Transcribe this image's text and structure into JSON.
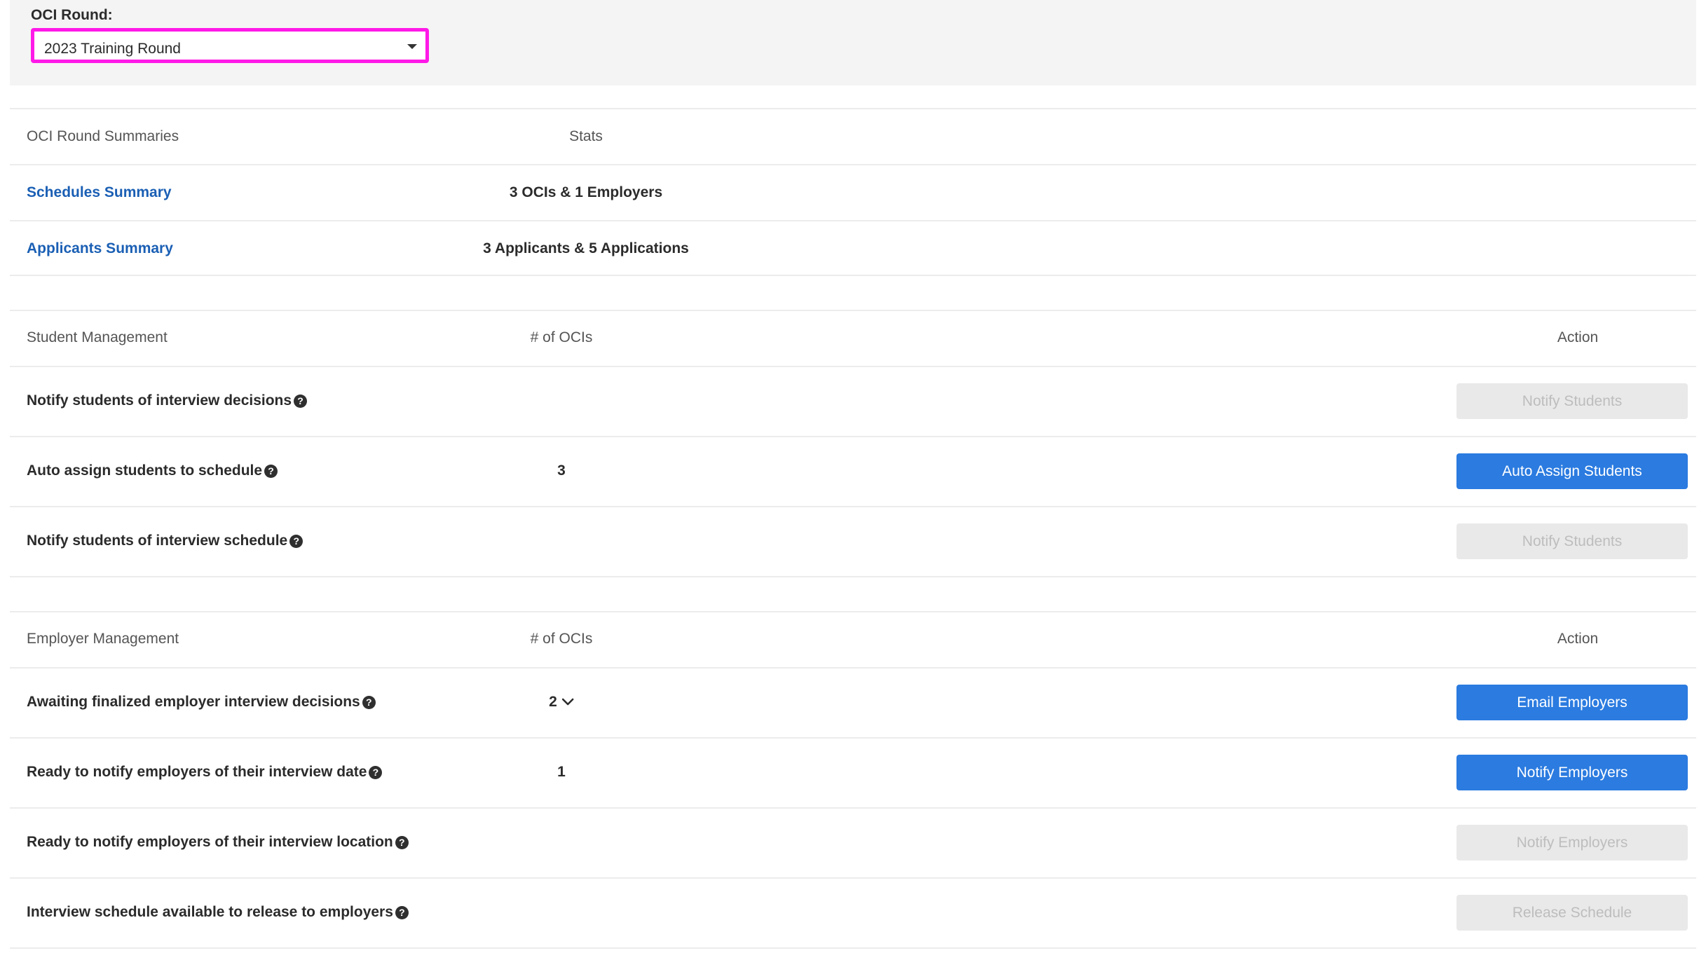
{
  "filter": {
    "label": "OCI Round:",
    "selected": "2023 Training Round"
  },
  "summaries": {
    "header_label": "OCI Round Summaries",
    "header_stats": "Stats",
    "rows": [
      {
        "label": "Schedules Summary",
        "stats": "3 OCIs & 1 Employers"
      },
      {
        "label": "Applicants Summary",
        "stats": "3 Applicants & 5 Applications"
      }
    ]
  },
  "student_management": {
    "header_label": "Student Management",
    "header_count": "# of OCIs",
    "header_action": "Action",
    "rows": [
      {
        "label": "Notify students of interview decisions",
        "count": "",
        "button": "Notify Students",
        "button_state": "disabled"
      },
      {
        "label": "Auto assign students to schedule",
        "count": "3",
        "button": "Auto Assign Students",
        "button_state": "enabled"
      },
      {
        "label": "Notify students of interview schedule",
        "count": "",
        "button": "Notify Students",
        "button_state": "disabled"
      }
    ]
  },
  "employer_management": {
    "header_label": "Employer Management",
    "header_count": "# of OCIs",
    "header_action": "Action",
    "rows": [
      {
        "label": "Awaiting finalized employer interview decisions",
        "count": "2",
        "button": "Email Employers",
        "button_state": "enabled"
      },
      {
        "label": "Ready to notify employers of their interview date",
        "count": "1",
        "button": "Notify Employers",
        "button_state": "enabled"
      },
      {
        "label": "Ready to notify employers of their interview location",
        "count": "",
        "button": "Notify Employers",
        "button_state": "disabled"
      },
      {
        "label": "Interview schedule available to release to employers",
        "count": "",
        "button": "Release Schedule",
        "button_state": "disabled"
      }
    ]
  },
  "icons": {
    "help": "question-circle-icon",
    "select_caret": "caret-down-icon",
    "expand": "chevron-down-icon"
  },
  "colors": {
    "focus_outline": "#ff19e8",
    "primary_button": "#2b7be0",
    "link": "#1a5fb4",
    "disabled_button": "#e9e9e9"
  }
}
